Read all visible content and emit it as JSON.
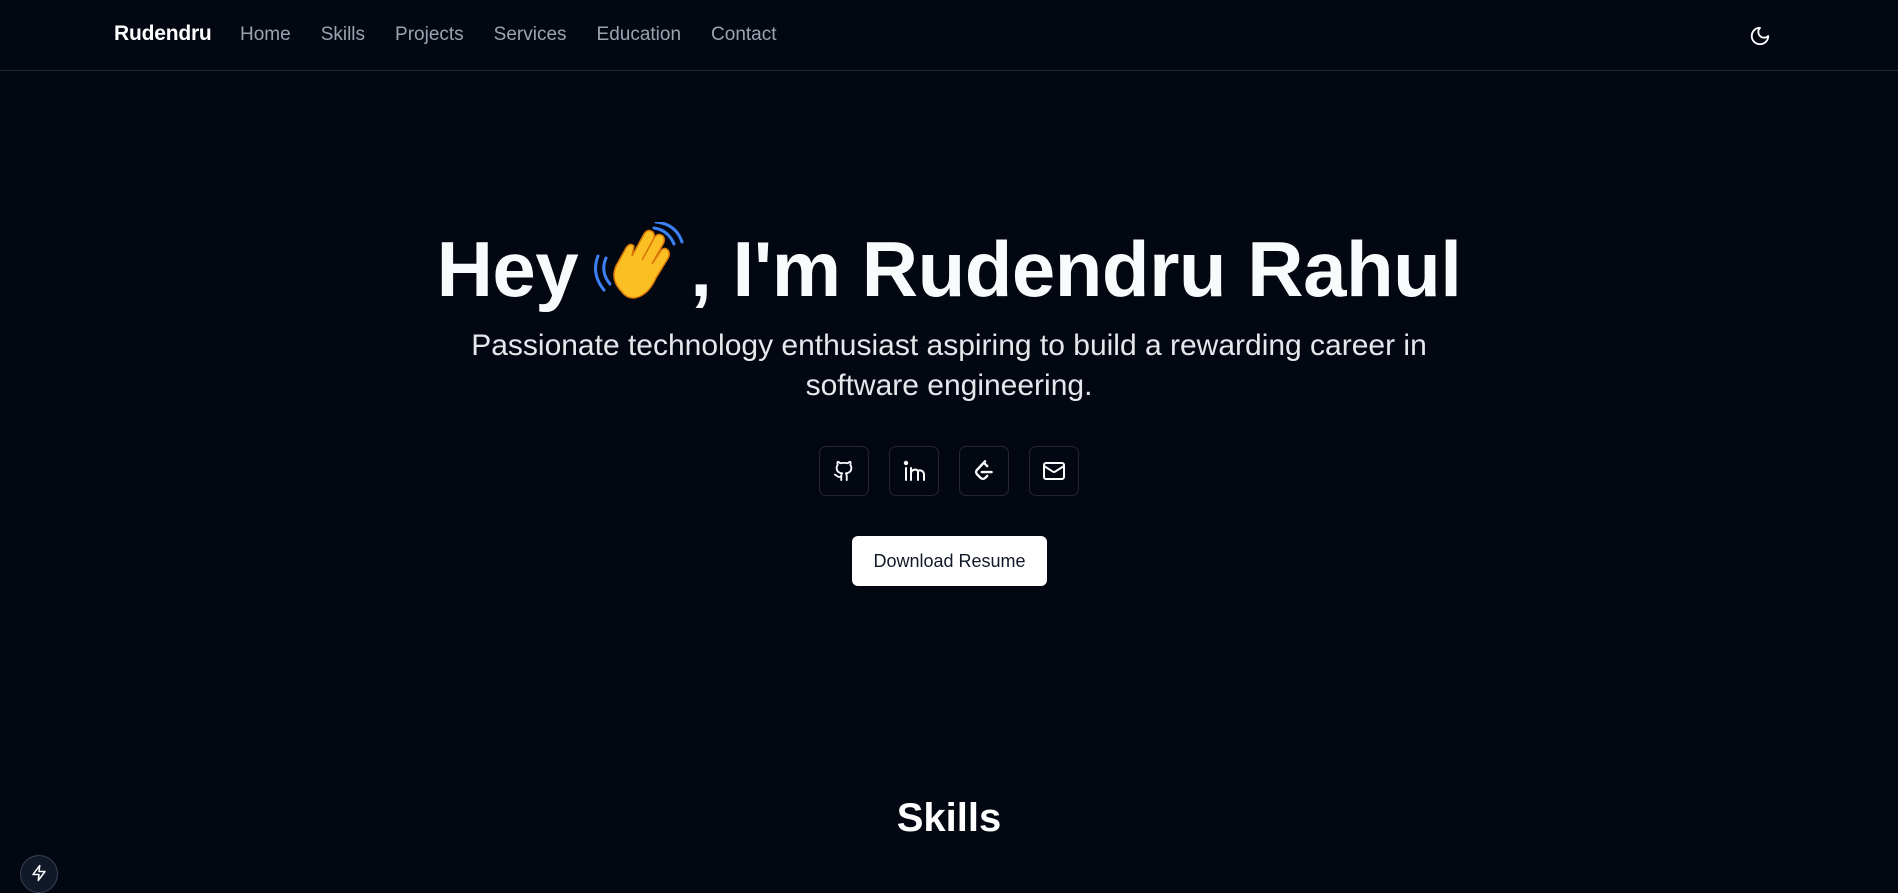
{
  "header": {
    "brand": "Rudendru",
    "nav": [
      {
        "label": "Home"
      },
      {
        "label": "Skills"
      },
      {
        "label": "Projects"
      },
      {
        "label": "Services"
      },
      {
        "label": "Education"
      },
      {
        "label": "Contact"
      }
    ],
    "theme_toggle_icon": "moon-icon"
  },
  "hero": {
    "title_prefix": "Hey",
    "title_emoji_icon": "waving-hand-icon",
    "title_suffix": ", I'm Rudendru Rahul",
    "subtitle": "Passionate technology enthusiast aspiring to build a rewarding career in software engineering.",
    "socials": [
      {
        "icon": "github-icon"
      },
      {
        "icon": "linkedin-icon"
      },
      {
        "icon": "leetcode-icon"
      },
      {
        "icon": "mail-icon"
      }
    ],
    "resume_label": "Download Resume"
  },
  "skills": {
    "title": "Skills"
  },
  "floating_button_icon": "lightning-icon",
  "colors": {
    "background": "#030712",
    "text": "#f9fafb",
    "nav_text": "#9ca3af",
    "border": "#1f2937",
    "button_bg": "#ffffff"
  }
}
